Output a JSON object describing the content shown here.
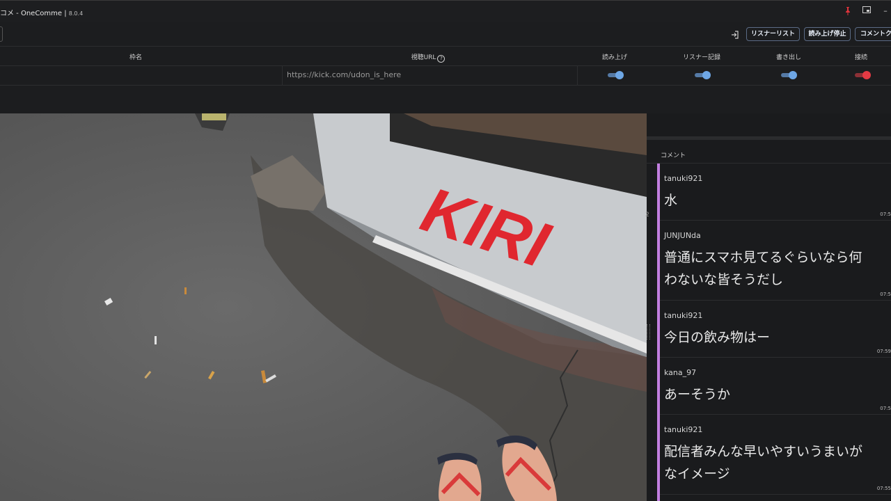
{
  "window": {
    "title": "コメ - OneComme | ",
    "version": "8.0.4"
  },
  "toolbar": {
    "buttons": [
      {
        "label": "リスナーリスト"
      },
      {
        "label": "読み上げ停止"
      },
      {
        "label": "コメントク"
      }
    ]
  },
  "table": {
    "headers": {
      "name": "枠名",
      "url": "視聴URL",
      "read": "読み上げ",
      "listener_log": "リスナー記録",
      "export": "書き出し",
      "connect": "接続"
    },
    "row": {
      "name": "",
      "url": "https://kick.com/udon_is_here",
      "read": true,
      "listener_log": true,
      "export": true,
      "connect": true
    }
  },
  "video": {
    "logo_text": "KIRI"
  },
  "comments_panel": {
    "header": "コメント",
    "side_marker": "2",
    "items": [
      {
        "user": "tanuki921",
        "lines": [
          "水"
        ],
        "time": "07:5"
      },
      {
        "user": "JUNJUNda",
        "lines": [
          "普通にスマホ見てるぐらいなら何",
          "わないな皆そうだし"
        ],
        "time": "07:5"
      },
      {
        "user": "tanuki921",
        "lines": [
          "今日の飲み物はー"
        ],
        "time": "07:59"
      },
      {
        "user": "kana_97",
        "lines": [
          "あーそうか"
        ],
        "time": "07:5"
      },
      {
        "user": "tanuki921",
        "lines": [
          "配信者みんな早いやすいうまいが",
          "なイメージ"
        ],
        "time": "07:55"
      }
    ]
  },
  "colors": {
    "accent": "#c27fe0",
    "toggle_on": "#6ea7e6",
    "connect_on": "#e43a44"
  }
}
